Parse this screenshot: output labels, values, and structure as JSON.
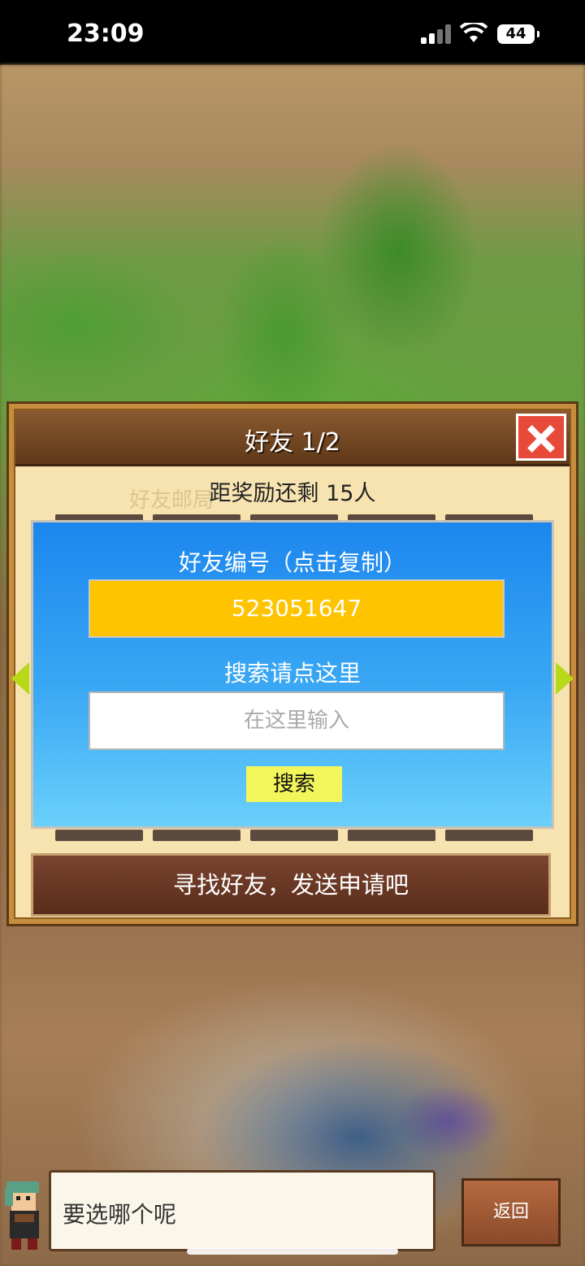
{
  "status_bar": {
    "time": "23:09",
    "battery": "44"
  },
  "dialog": {
    "title": "好友 1/2",
    "reward_text": "距奖励还剩 15人",
    "ghost_text": "好友邮局"
  },
  "panel": {
    "friend_id_label": "好友编号（点击复制）",
    "friend_id": "523051647",
    "search_label": "搜索请点这里",
    "search_placeholder": "在这里输入",
    "search_button": "搜索"
  },
  "find_button": "寻找好友，发送申请吧",
  "bottom": {
    "speech": "要选哪个呢",
    "back_button": "返回"
  },
  "colors": {
    "panel_blue": "#1d86ee",
    "id_yellow": "#ffc400",
    "search_button": "#f3f65a",
    "close_red": "#e84a3a"
  }
}
